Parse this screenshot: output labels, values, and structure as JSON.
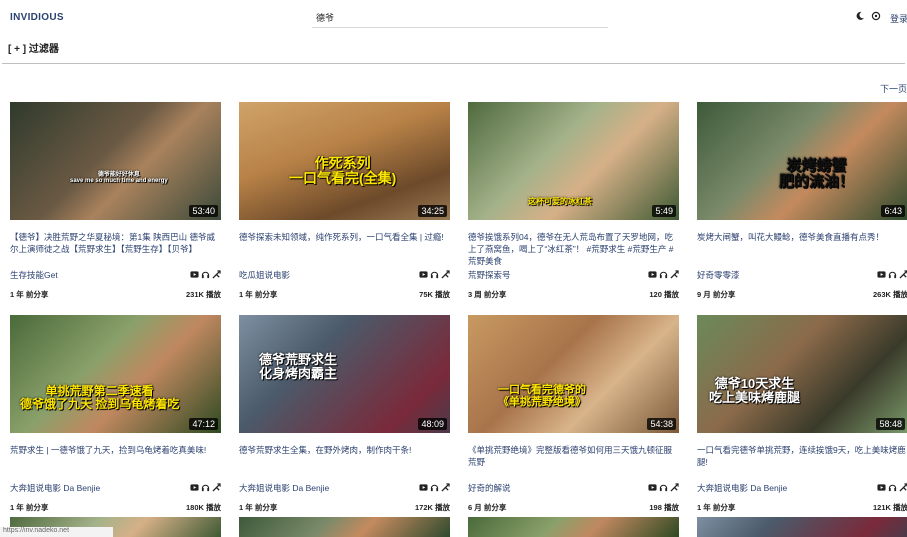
{
  "header": {
    "brand": "INVIDIOUS",
    "search_value": "德爷",
    "login_label": "登录",
    "icons": [
      "moon-icon",
      "gear-icon"
    ]
  },
  "filter_label": "[ + ]  过滤器",
  "next_page_label": "下一页",
  "status_text": "https://inv.nadeko.net",
  "videos": [
    {
      "title": "【德爷】决胜荒野之华夏秘境：第1集 陕西巴山 德爷威尔上演师徒之战【荒野求生】【荒野生存】【贝爷】",
      "channel": "生存技能Get",
      "duration": "53:40",
      "ago": "1 年 前分享",
      "views": "231K 播放",
      "overlay": "德爷能好好休息\nsave me so much time and energy"
    },
    {
      "title": "德爷探索未知领域，纯作死系列，一口气看全集 | 过瘾!",
      "channel": "吃瓜姐说电影",
      "duration": "34:25",
      "ago": "1 年 前分享",
      "views": "75K 播放",
      "overlay": "作死系列\n一口气看完(全集)"
    },
    {
      "title": "德爷挨饿系列04，德爷在无人荒岛布置了天罗地网，吃上了燕窝鱼，喝上了“冰红茶”！ #荒野求生 #荒野生产 #荒野美食",
      "channel": "荒野探索号",
      "duration": "5:49",
      "ago": "3 周 前分享",
      "views": "120 播放",
      "overlay": "这杯可爱的冰红茶"
    },
    {
      "title": "炭烤大闸蟹，叫花大鳗鲶，德爷美食直播有点秀！",
      "channel": "好奇零零漆",
      "duration": "6:43",
      "ago": "9 月 前分享",
      "views": "263K 播放",
      "overlay": "炭烤螃蟹\n肥的流油！"
    },
    {
      "title": "荒野求生 | 一德爷饿了九天，捡到乌龟烤着吃真美味!",
      "channel": "大奔姐说电影 Da Benjie",
      "duration": "47:12",
      "ago": "1 年 前分享",
      "views": "180K 播放",
      "overlay": "单挑荒野第二季速看\n德爷饿了九天 捡到乌龟烤着吃"
    },
    {
      "title": "德爷荒野求生全集，在野外烤肉，制作肉干条!",
      "channel": "大奔姐说电影 Da Benjie",
      "duration": "48:09",
      "ago": "1 年 前分享",
      "views": "172K 播放",
      "overlay": "德爷荒野求生\n化身烤肉霸主"
    },
    {
      "title": "《单挑荒野绝境》完整版看德爷如何用三天饿九顿征服荒野",
      "channel": "好奇的解说",
      "duration": "54:38",
      "ago": "6 月 前分享",
      "views": "198 播放",
      "overlay": "一口气看完德爷的\n《单挑荒野绝境》"
    },
    {
      "title": "一口气看完德爷单挑荒野，连续挨饿9天，吃上美味烤鹿腿!",
      "channel": "大奔姐说电影 Da Benjie",
      "duration": "58:48",
      "ago": "1 年 前分享",
      "views": "121K 播放",
      "overlay": "德爷10天求生\n吃上美味烤鹿腿"
    }
  ],
  "colors": {
    "link": "#2c4270",
    "overlay_yellow": "#ffe600",
    "overlay_orange": "#ff6a00",
    "overlay_white": "#ffffff"
  }
}
